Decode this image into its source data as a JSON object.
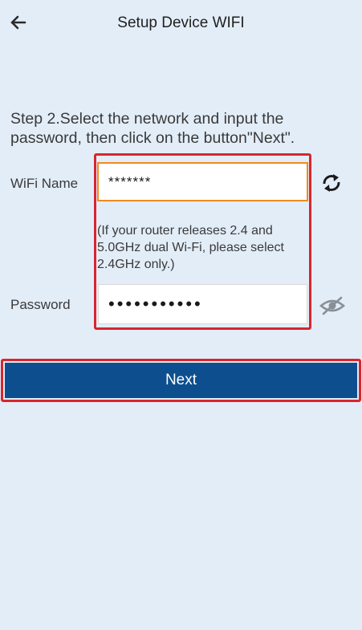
{
  "header": {
    "title": "Setup Device WIFI",
    "back_icon": "arrow-left-icon"
  },
  "instruction": "Step 2.Select the network and input the password, then click on the button\"Next\".",
  "wifi": {
    "label": "WiFi Name",
    "value": "*******",
    "refresh_icon": "refresh-icon"
  },
  "hint": "(If your router releases 2.4 and 5.0GHz dual Wi-Fi, please select 2.4GHz only.)",
  "password": {
    "label": "Password",
    "value": "•••••••••••",
    "visibility_icon": "eye-off-icon"
  },
  "actions": {
    "next_label": "Next"
  },
  "colors": {
    "background": "#e3edf8",
    "accent": "#0d4f8e",
    "highlight_border": "#d8262e",
    "focus_border": "#f08a1e"
  }
}
